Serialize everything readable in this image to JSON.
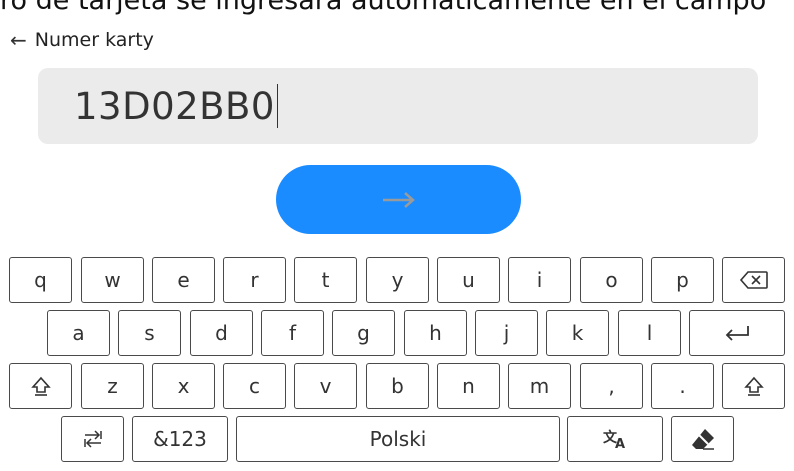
{
  "caption_partial": "ro de tarjeta se ingresará automáticamente en el campo",
  "header": {
    "back_icon": "arrow-left-icon",
    "back_glyph": "←",
    "title": "Numer karty"
  },
  "input": {
    "value": "13D02BB0"
  },
  "submit_button": {
    "icon": "arrow-right-icon"
  },
  "keyboard": {
    "row1": [
      "q",
      "w",
      "e",
      "r",
      "t",
      "y",
      "u",
      "i",
      "o",
      "p"
    ],
    "row2": [
      "a",
      "s",
      "d",
      "f",
      "g",
      "h",
      "j",
      "k",
      "l"
    ],
    "row3": [
      "z",
      "x",
      "c",
      "v",
      "b",
      "n",
      "m",
      ",",
      "."
    ],
    "symbols_label": "&123",
    "space_label": "Polski",
    "icons": {
      "backspace": "backspace-icon",
      "enter": "enter-icon",
      "shift": "shift-icon",
      "switch": "keyboard-switch-icon",
      "translate": "translate-icon",
      "clear": "eraser-icon"
    }
  },
  "colors": {
    "accent": "#1a8cff",
    "input_bg": "#ebebeb"
  }
}
